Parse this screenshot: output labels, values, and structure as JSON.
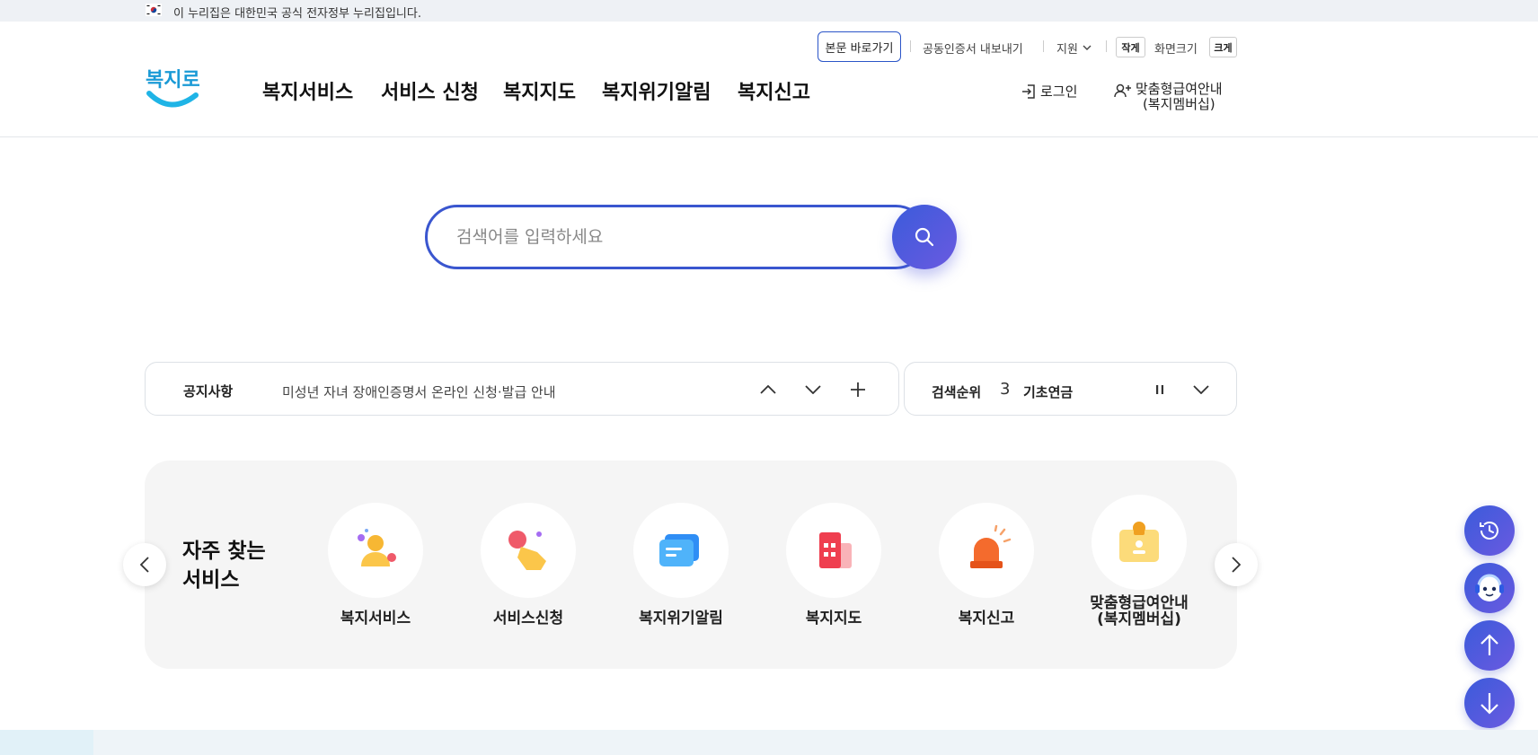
{
  "gov_bar": {
    "text": "이 누리집은 대한민국 공식 전자정부 누리집입니다."
  },
  "util": {
    "skip_label": "본문 바로가기",
    "cert_export": "공동인증서 내보내기",
    "support": "지원",
    "font_small": "작게",
    "font_size": "화면크기",
    "font_large": "크게"
  },
  "logo": {
    "text": "복지로"
  },
  "gnb": {
    "items": [
      "복지서비스",
      "서비스 신청",
      "복지지도",
      "복지위기알림",
      "복지신고"
    ]
  },
  "account": {
    "login": "로그인",
    "member_line1": "맞춤형급여안내",
    "member_line2": "(복지멤버십)"
  },
  "search": {
    "placeholder": "검색어를 입력하세요"
  },
  "notice": {
    "label": "공지사항",
    "text": "미성년 자녀 장애인증명서 온라인 신청·발급 안내"
  },
  "rank": {
    "label": "검색순위",
    "number": "3",
    "keyword": "기초연금"
  },
  "frequent": {
    "title_line1": "자주 찾는",
    "title_line2": "서비스",
    "items": [
      {
        "name": "복지서비스",
        "icon": "person-icon"
      },
      {
        "name": "서비스신청",
        "icon": "hand-tap-icon"
      },
      {
        "name": "복지위기알림",
        "icon": "message-icon"
      },
      {
        "name": "복지지도",
        "icon": "building-icon"
      },
      {
        "name": "복지신고",
        "icon": "siren-icon"
      },
      {
        "name_line1": "맞춤형급여안내",
        "name_line2": "(복지멤버십)",
        "icon": "badge-icon"
      }
    ]
  },
  "colors": {
    "accent": "#3a56cf",
    "gradient_end": "#6a5ae0",
    "panel": "#f5f5f5"
  }
}
